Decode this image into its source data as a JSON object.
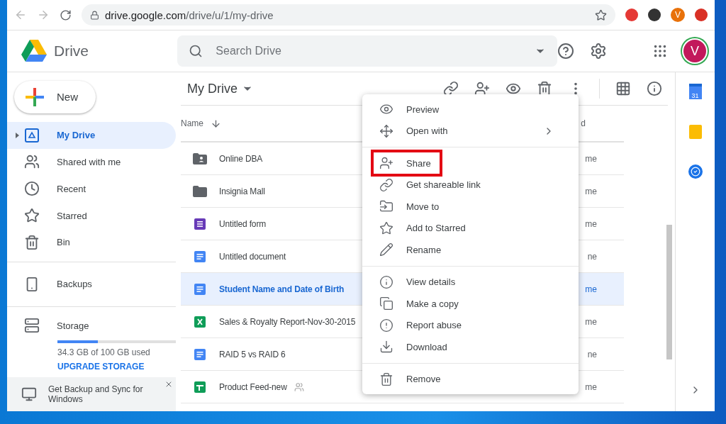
{
  "browser": {
    "url_host": "drive.google.com",
    "url_path": "/drive/u/1/my-drive",
    "profile_initial": "V"
  },
  "header": {
    "app_name": "Drive",
    "search_placeholder": "Search Drive",
    "avatar_initial": "V"
  },
  "new_button": "New",
  "sidebar": {
    "items": [
      {
        "label": "My Drive",
        "kind": "drive",
        "selected": true
      },
      {
        "label": "Shared with me",
        "kind": "shared",
        "selected": false
      },
      {
        "label": "Recent",
        "kind": "recent",
        "selected": false
      },
      {
        "label": "Starred",
        "kind": "starred",
        "selected": false
      },
      {
        "label": "Bin",
        "kind": "bin",
        "selected": false
      }
    ],
    "backups": "Backups",
    "storage": {
      "label": "Storage",
      "level": 0.343,
      "usage": "34.3 GB of 100 GB used",
      "upgrade": "UPGRADE STORAGE"
    },
    "promo": "Get Backup and Sync for Windows"
  },
  "title": "My Drive",
  "table": {
    "columns": [
      "Name",
      "d"
    ],
    "rows": [
      {
        "name": "Online DBA",
        "kind": "shared-folder",
        "selected": false,
        "shared": false,
        "column_2": "me"
      },
      {
        "name": "Insignia Mall",
        "kind": "folder",
        "selected": false,
        "shared": false,
        "column_2": "me"
      },
      {
        "name": "Untitled form",
        "kind": "form",
        "selected": false,
        "shared": false,
        "column_2": "me"
      },
      {
        "name": "Untitled document",
        "kind": "doc",
        "selected": false,
        "shared": false,
        "column_2": "ne"
      },
      {
        "name": "Student Name and Date of Birth",
        "kind": "doc",
        "selected": true,
        "shared": false,
        "column_2": "me"
      },
      {
        "name": "Sales & Royalty Report-Nov-30-2015",
        "kind": "excel",
        "selected": false,
        "shared": false,
        "column_2": "me"
      },
      {
        "name": "RAID 5 vs RAID 6",
        "kind": "doc",
        "selected": false,
        "shared": false,
        "column_2": "ne"
      },
      {
        "name": "Product Feed-new",
        "kind": "sheet",
        "selected": false,
        "shared": true,
        "column_2": "me"
      }
    ]
  },
  "context_menu": {
    "groups": [
      [
        {
          "label": "Preview",
          "kind": "preview",
          "submenu": false,
          "highlighted": false
        },
        {
          "label": "Open with",
          "kind": "open",
          "submenu": true,
          "highlighted": false
        }
      ],
      [
        {
          "label": "Share",
          "kind": "share",
          "submenu": false,
          "highlighted": true
        },
        {
          "label": "Get shareable link",
          "kind": "link",
          "submenu": false,
          "highlighted": false
        },
        {
          "label": "Move to",
          "kind": "move",
          "submenu": false,
          "highlighted": false
        },
        {
          "label": "Add to Starred",
          "kind": "star",
          "submenu": false,
          "highlighted": false
        },
        {
          "label": "Rename",
          "kind": "rename",
          "submenu": false,
          "highlighted": false
        }
      ],
      [
        {
          "label": "View details",
          "kind": "details",
          "submenu": false,
          "highlighted": false
        },
        {
          "label": "Make a copy",
          "kind": "copy",
          "submenu": false,
          "highlighted": false
        },
        {
          "label": "Report abuse",
          "kind": "report",
          "submenu": false,
          "highlighted": false
        },
        {
          "label": "Download",
          "kind": "download",
          "submenu": false,
          "highlighted": false
        }
      ],
      [
        {
          "label": "Remove",
          "kind": "remove",
          "submenu": false,
          "highlighted": false
        }
      ]
    ]
  },
  "side_panel": {
    "calendar_day": "31"
  }
}
